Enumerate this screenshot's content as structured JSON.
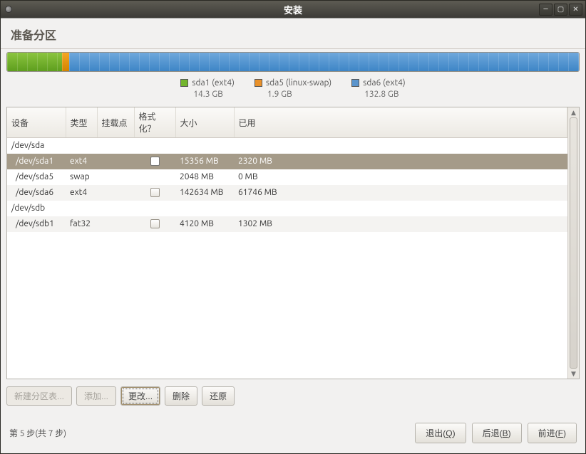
{
  "window_title": "安装",
  "page_heading": "准备分区",
  "legend": [
    {
      "label": "sda1 (ext4)",
      "size": "14.3 GB",
      "color": "g"
    },
    {
      "label": "sda5 (linux-swap)",
      "size": "1.9 GB",
      "color": "o"
    },
    {
      "label": "sda6 (ext4)",
      "size": "132.8 GB",
      "color": "b"
    }
  ],
  "columns": {
    "device": "设备",
    "type": "类型",
    "mount": "挂载点",
    "format": "格式化？",
    "size": "大小",
    "used": "已用"
  },
  "rows": [
    {
      "device": "/dev/sda",
      "type": "",
      "mount": "",
      "format": null,
      "size": "",
      "used": "",
      "selected": false,
      "alt": false
    },
    {
      "device": " /dev/sda1",
      "type": "ext4",
      "mount": "",
      "format": false,
      "size": "15356 MB",
      "used": "2320 MB",
      "selected": true,
      "alt": false
    },
    {
      "device": " /dev/sda5",
      "type": "swap",
      "mount": "",
      "format": null,
      "size": "2048 MB",
      "used": "0 MB",
      "selected": false,
      "alt": false
    },
    {
      "device": " /dev/sda6",
      "type": "ext4",
      "mount": "",
      "format": false,
      "size": "142634 MB",
      "used": "61746 MB",
      "selected": false,
      "alt": true
    },
    {
      "device": "/dev/sdb",
      "type": "",
      "mount": "",
      "format": null,
      "size": "",
      "used": "",
      "selected": false,
      "alt": false
    },
    {
      "device": " /dev/sdb1",
      "type": "fat32",
      "mount": "",
      "format": false,
      "size": "4120 MB",
      "used": "1302 MB",
      "selected": false,
      "alt": true
    }
  ],
  "actions": {
    "new_table": "新建分区表...",
    "add": "添加...",
    "change": "更改...",
    "delete": "删除",
    "revert": "还原"
  },
  "step": "第 5 步(共 7 步)",
  "footer_buttons": {
    "quit": {
      "prefix": "退出(",
      "key": "Q",
      "suffix": ")"
    },
    "back": {
      "prefix": "后退(",
      "key": "B",
      "suffix": ")"
    },
    "forward": {
      "prefix": "前进(",
      "key": "F",
      "suffix": ")"
    }
  },
  "diskbar_segments": [
    {
      "class": "green",
      "width": 9.6
    },
    {
      "class": "orange",
      "width": 1.3
    },
    {
      "class": "blue",
      "width": 89.1
    }
  ]
}
